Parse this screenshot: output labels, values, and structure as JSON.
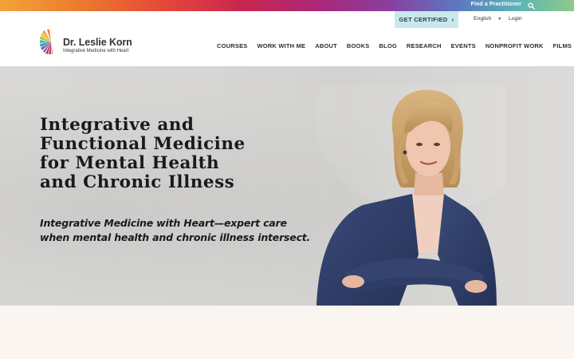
{
  "colors": {
    "accent_cert": "#c9e8ee",
    "below_bg": "#faf5f0",
    "text_dark": "#1a1a1a"
  },
  "topbar": {
    "find_label": "Find a Practitioner",
    "search_icon": "search-icon"
  },
  "logo": {
    "name": "Dr. Leslie Korn",
    "tagline": "Integrative Medicine with Heart"
  },
  "header": {
    "cert_label": "GET CERTIFIED",
    "cert_icon": "chevron-right-icon",
    "language": "English",
    "login_label": "Login"
  },
  "nav": [
    {
      "label": "COURSES"
    },
    {
      "label": "WORK WITH ME"
    },
    {
      "label": "ABOUT"
    },
    {
      "label": "BOOKS"
    },
    {
      "label": "BLOG"
    },
    {
      "label": "RESEARCH"
    },
    {
      "label": "EVENTS"
    },
    {
      "label": "NONPROFIT WORK"
    },
    {
      "label": "FILMS"
    }
  ],
  "hero": {
    "title_lines": [
      "Integrative and",
      "Functional Medicine",
      "for Mental Health",
      "and Chronic Illness"
    ],
    "subtitle": "Integrative Medicine with Heart—expert care when mental health and chronic illness intersect."
  }
}
